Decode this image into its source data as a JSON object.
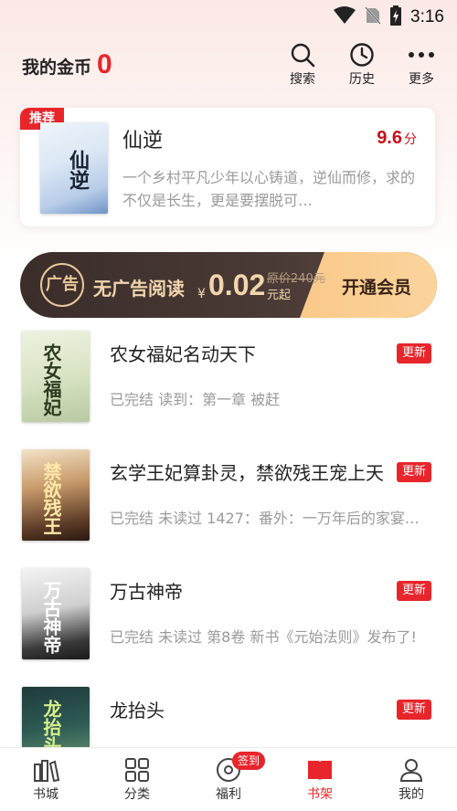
{
  "status_bar": {
    "time": "3:16"
  },
  "header": {
    "coins_label": "我的金币",
    "coins_value": "0",
    "buttons": [
      {
        "label": "搜索",
        "icon": "search-icon"
      },
      {
        "label": "历史",
        "icon": "clock-icon"
      },
      {
        "label": "更多",
        "icon": "more-icon"
      }
    ]
  },
  "recommend": {
    "badge": "推荐",
    "title": "仙逆",
    "score": "9.6",
    "score_unit": "分",
    "description": "一个乡村平凡少年以心铸道，逆仙而修，求的不仅是长生，更是要摆脱可…",
    "cover_text": "仙逆"
  },
  "vip": {
    "logo_text": "广告",
    "title": "无广告阅读",
    "currency": "¥",
    "price": "0.02",
    "original_price": "原价240元",
    "price_suffix": "元起",
    "cta": "开通会员"
  },
  "books": [
    {
      "title": "农女福妃名动天下",
      "meta": "已完结 读到：第一章 被赶",
      "badge": "更新",
      "cover_text": "农女福妃"
    },
    {
      "title": "玄学王妃算卦灵，禁欲残王宠上天",
      "meta": "已完结 未读过 1427：番外：一万年后的家宴…",
      "badge": "更新",
      "cover_text": "禁欲残王"
    },
    {
      "title": "万古神帝",
      "meta": "已完结 未读过 第8卷 新书《元始法则》发布了!",
      "badge": "更新",
      "cover_text": "万古神帝"
    },
    {
      "title": "龙抬头",
      "meta": "",
      "badge": "更新",
      "cover_text": "龙抬头"
    }
  ],
  "bottom_nav": {
    "sign_badge": "签到",
    "items": [
      {
        "label": "书城",
        "icon": "bookstore-icon"
      },
      {
        "label": "分类",
        "icon": "category-icon"
      },
      {
        "label": "福利",
        "icon": "coin-icon"
      },
      {
        "label": "书架",
        "icon": "bookshelf-icon",
        "active": true
      },
      {
        "label": "我的",
        "icon": "user-icon"
      }
    ]
  },
  "colors": {
    "accent": "#e8252b",
    "vip_gold": "#f9c98a",
    "vip_dark": "#3a2d2a"
  }
}
